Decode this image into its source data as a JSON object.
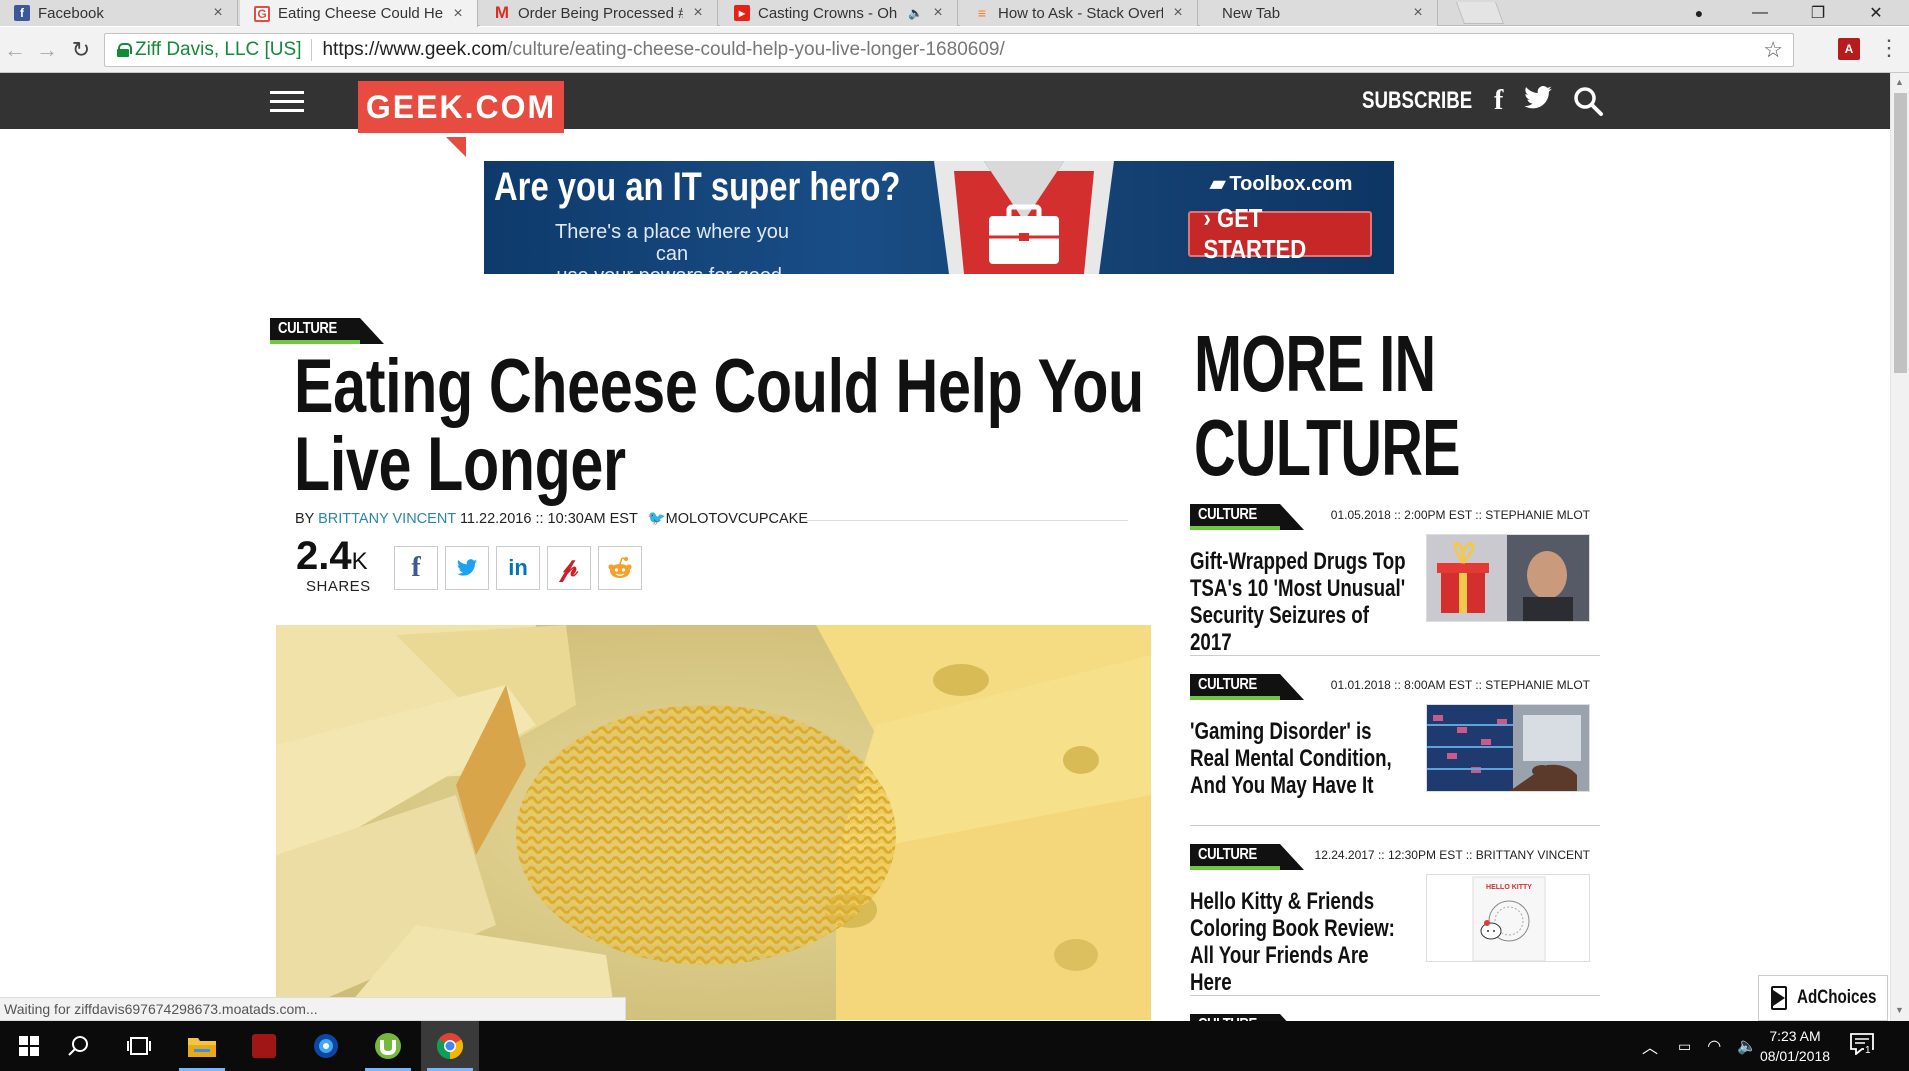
{
  "browser": {
    "tabs": [
      {
        "title": "Facebook",
        "favicon": "facebook-icon",
        "color": "#3b5998",
        "glyph": "f",
        "active": false
      },
      {
        "title": "Eating Cheese Could Hel",
        "favicon": "geek-icon",
        "color": "#e84b3f",
        "glyph": "G",
        "active": true
      },
      {
        "title": "Order Being Processed #",
        "favicon": "gmail-icon",
        "color": "#d93025",
        "glyph": "M",
        "active": false
      },
      {
        "title": "Casting Crowns - Oh",
        "favicon": "youtube-icon",
        "color": "#e62117",
        "glyph": "▶",
        "active": false,
        "audio": true
      },
      {
        "title": "How to Ask - Stack Overf",
        "favicon": "stackoverflow-icon",
        "color": "#f48024",
        "glyph": "≡",
        "active": false
      },
      {
        "title": "New Tab",
        "favicon": "",
        "color": "",
        "glyph": "",
        "active": false
      }
    ],
    "window_controls": {
      "account": "●",
      "minimize": "—",
      "restore": "❐",
      "close": "✕"
    },
    "secure_label": "Ziff Davis, LLC [US]",
    "url_host": "https://www.geek.com",
    "url_path": "/culture/eating-cheese-could-help-you-live-longer-1680609/",
    "status_text": "Waiting for ziffdavis697674298673.moatads.com..."
  },
  "site": {
    "logo": "GEEK.COM",
    "subscribe": "SUBSCRIBE"
  },
  "ad": {
    "headline": "Are you an IT super hero?",
    "subline_1": "There's a place where you can",
    "subline_2": "use your powers for good.",
    "brand": "Toolbox.com",
    "cta": "› GET STARTED"
  },
  "article": {
    "category": "CULTURE",
    "title": "Eating Cheese Could Help You Live Longer",
    "by": "BY",
    "author": "BRITTANY VINCENT",
    "date": "11.22.2016 :: 10:30AM EST",
    "twitter": "MOLOTOVCUPCAKE",
    "share_count": "2.4",
    "share_unit": "K",
    "shares_label": "SHARES",
    "share_buttons": [
      {
        "name": "facebook",
        "glyph": "f",
        "color": "#3b5998"
      },
      {
        "name": "twitter",
        "glyph": "🐦",
        "color": "#1da1f2"
      },
      {
        "name": "linkedin",
        "glyph": "in",
        "color": "#0077b5"
      },
      {
        "name": "pinterest",
        "glyph": "P",
        "color": "#cb2027"
      },
      {
        "name": "reddit",
        "glyph": "◉",
        "color": "#ff6314"
      }
    ]
  },
  "sidebar": {
    "title_line1": "MORE IN",
    "title_line2": "CULTURE",
    "cards": [
      {
        "category": "CULTURE",
        "meta": "01.05.2018 :: 2:00PM EST :: STEPHANIE MLOT",
        "title": "Gift-Wrapped Drugs Top TSA's 10 'Most Unusual' Security Seizures of 2017"
      },
      {
        "category": "CULTURE",
        "meta": "01.01.2018 :: 8:00AM EST :: STEPHANIE MLOT",
        "title": "'Gaming Disorder' is Real Mental Condition, And You May Have It"
      },
      {
        "category": "CULTURE",
        "meta": "12.24.2017 :: 12:30PM EST :: BRITTANY VINCENT",
        "title": "Hello Kitty & Friends Coloring Book Review: All Your Friends Are Here"
      },
      {
        "category": "CULTURE",
        "meta": "",
        "title": ""
      }
    ],
    "thumb3_text": "HELLO KITTY"
  },
  "adchoices": "AdChoices",
  "taskbar": {
    "time": "7:23 AM",
    "date": "08/01/2018",
    "notifications": "1"
  },
  "colors": {
    "accent": "#e84b3f",
    "header_bg": "#333333",
    "tag_green": "#6dc740",
    "link_blue": "#2a86a8"
  }
}
